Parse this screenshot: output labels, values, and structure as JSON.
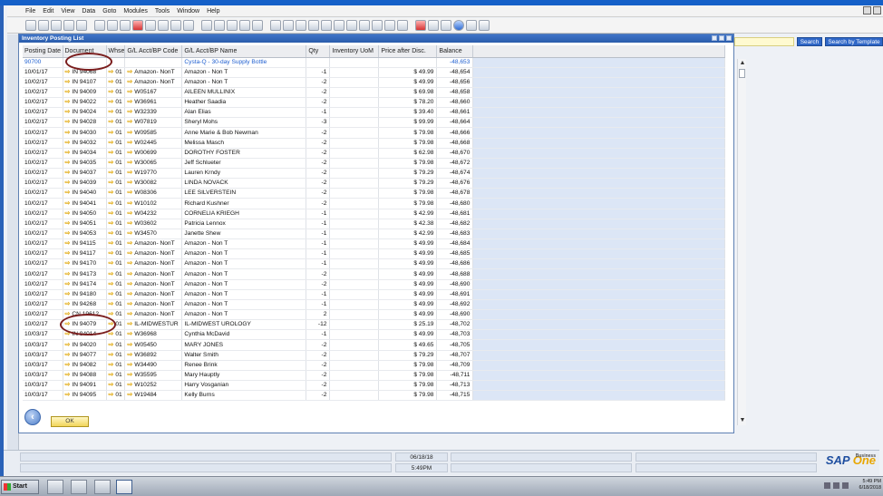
{
  "menu": [
    "File",
    "Edit",
    "View",
    "Data",
    "Goto",
    "Modules",
    "Tools",
    "Window",
    "Help"
  ],
  "search": {
    "placeholder": "",
    "button": "Search",
    "button_template": "Search by Template"
  },
  "dialog": {
    "title": "Inventory Posting List",
    "columns": [
      "Posting Date",
      "Document",
      "Whse",
      "G/L Acct/BP Code",
      "G/L Acct/BP Name",
      "Qty",
      "Inventory UoM",
      "Price after Disc.",
      "Balance"
    ],
    "ok_label": "OK"
  },
  "rows": [
    {
      "date": "90700",
      "doc": "",
      "whse": "",
      "code": "",
      "name": "Cysta-Q - 30-day Supply  Bottle",
      "qty": "",
      "uom": "",
      "price": "",
      "bal": "-48,653",
      "first": true
    },
    {
      "date": "10/01/17",
      "doc": "IN 94068",
      "whse": "01",
      "code": "Amazon- NonT",
      "name": "Amazon - Non T",
      "qty": "-1",
      "uom": "",
      "price": "$ 49.99",
      "bal": "-48,654"
    },
    {
      "date": "10/02/17",
      "doc": "IN 94107",
      "whse": "01",
      "code": "Amazon- NonT",
      "name": "Amazon - Non T",
      "qty": "-2",
      "uom": "",
      "price": "$ 49.99",
      "bal": "-48,656"
    },
    {
      "date": "10/02/17",
      "doc": "IN 94009",
      "whse": "01",
      "code": "W05167",
      "name": "AILEEN  MULLINIX",
      "qty": "-2",
      "uom": "",
      "price": "$ 69.98",
      "bal": "-48,658"
    },
    {
      "date": "10/02/17",
      "doc": "IN 94022",
      "whse": "01",
      "code": "W36961",
      "name": "Heather Saadia",
      "qty": "-2",
      "uom": "",
      "price": "$ 78.20",
      "bal": "-48,660"
    },
    {
      "date": "10/02/17",
      "doc": "IN 94024",
      "whse": "01",
      "code": "W32339",
      "name": "Alan Elias",
      "qty": "-1",
      "uom": "",
      "price": "$ 39.40",
      "bal": "-48,661"
    },
    {
      "date": "10/02/17",
      "doc": "IN 94028",
      "whse": "01",
      "code": "W07819",
      "name": "Sheryl Mohs",
      "qty": "-3",
      "uom": "",
      "price": "$ 99.99",
      "bal": "-48,664"
    },
    {
      "date": "10/02/17",
      "doc": "IN 94030",
      "whse": "01",
      "code": "W09585",
      "name": "Anne Marie & Bob Newman",
      "qty": "-2",
      "uom": "",
      "price": "$ 79.98",
      "bal": "-48,666"
    },
    {
      "date": "10/02/17",
      "doc": "IN 94032",
      "whse": "01",
      "code": "W02445",
      "name": "Melissa Masch",
      "qty": "-2",
      "uom": "",
      "price": "$ 79.98",
      "bal": "-48,668"
    },
    {
      "date": "10/02/17",
      "doc": "IN 94034",
      "whse": "01",
      "code": "W00699",
      "name": "DOROTHY  FOSTER",
      "qty": "-2",
      "uom": "",
      "price": "$ 62.98",
      "bal": "-48,670"
    },
    {
      "date": "10/02/17",
      "doc": "IN 94035",
      "whse": "01",
      "code": "W30065",
      "name": "Jeff Schlueter",
      "qty": "-2",
      "uom": "",
      "price": "$ 79.98",
      "bal": "-48,672"
    },
    {
      "date": "10/02/17",
      "doc": "IN 94037",
      "whse": "01",
      "code": "W19770",
      "name": "Lauren Krndy",
      "qty": "-2",
      "uom": "",
      "price": "$ 79.29",
      "bal": "-48,674"
    },
    {
      "date": "10/02/17",
      "doc": "IN 94039",
      "whse": "01",
      "code": "W30082",
      "name": "LINDA NOVACK",
      "qty": "-2",
      "uom": "",
      "price": "$ 79.29",
      "bal": "-48,676"
    },
    {
      "date": "10/02/17",
      "doc": "IN 94040",
      "whse": "01",
      "code": "W08306",
      "name": "LEE SILVERSTEIN",
      "qty": "-2",
      "uom": "",
      "price": "$ 79.98",
      "bal": "-48,678"
    },
    {
      "date": "10/02/17",
      "doc": "IN 94041",
      "whse": "01",
      "code": "W10102",
      "name": "Richard Kushner",
      "qty": "-2",
      "uom": "",
      "price": "$ 79.98",
      "bal": "-48,680"
    },
    {
      "date": "10/02/17",
      "doc": "IN 94050",
      "whse": "01",
      "code": "W04232",
      "name": "CORNELIA  KRIEGH",
      "qty": "-1",
      "uom": "",
      "price": "$ 42.99",
      "bal": "-48,681"
    },
    {
      "date": "10/02/17",
      "doc": "IN 94051",
      "whse": "01",
      "code": "W03602",
      "name": "Patricia  Lennox",
      "qty": "-1",
      "uom": "",
      "price": "$ 42.38",
      "bal": "-48,682"
    },
    {
      "date": "10/02/17",
      "doc": "IN 94053",
      "whse": "01",
      "code": "W34570",
      "name": "Janette Shew",
      "qty": "-1",
      "uom": "",
      "price": "$ 42.99",
      "bal": "-48,683"
    },
    {
      "date": "10/02/17",
      "doc": "IN 94115",
      "whse": "01",
      "code": "Amazon- NonT",
      "name": "Amazon - Non T",
      "qty": "-1",
      "uom": "",
      "price": "$ 49.99",
      "bal": "-48,684"
    },
    {
      "date": "10/02/17",
      "doc": "IN 94117",
      "whse": "01",
      "code": "Amazon- NonT",
      "name": "Amazon - Non T",
      "qty": "-1",
      "uom": "",
      "price": "$ 49.99",
      "bal": "-48,685"
    },
    {
      "date": "10/02/17",
      "doc": "IN 94170",
      "whse": "01",
      "code": "Amazon- NonT",
      "name": "Amazon - Non T",
      "qty": "-1",
      "uom": "",
      "price": "$ 49.99",
      "bal": "-48,686"
    },
    {
      "date": "10/02/17",
      "doc": "IN 94173",
      "whse": "01",
      "code": "Amazon- NonT",
      "name": "Amazon - Non T",
      "qty": "-2",
      "uom": "",
      "price": "$ 49.99",
      "bal": "-48,688"
    },
    {
      "date": "10/02/17",
      "doc": "IN 94174",
      "whse": "01",
      "code": "Amazon- NonT",
      "name": "Amazon - Non T",
      "qty": "-2",
      "uom": "",
      "price": "$ 49.99",
      "bal": "-48,690"
    },
    {
      "date": "10/02/17",
      "doc": "IN 94180",
      "whse": "01",
      "code": "Amazon- NonT",
      "name": "Amazon - Non T",
      "qty": "-1",
      "uom": "",
      "price": "$ 49.99",
      "bal": "-48,691"
    },
    {
      "date": "10/02/17",
      "doc": "IN 94268",
      "whse": "01",
      "code": "Amazon- NonT",
      "name": "Amazon - Non T",
      "qty": "-1",
      "uom": "",
      "price": "$ 49.99",
      "bal": "-48,692"
    },
    {
      "date": "10/02/17",
      "doc": "CN 19612",
      "whse": "01",
      "code": "Amazon- NonT",
      "name": "Amazon - Non T",
      "qty": "2",
      "uom": "",
      "price": "$ 49.99",
      "bal": "-48,690"
    },
    {
      "date": "10/02/17",
      "doc": "IN 94079",
      "whse": "01",
      "code": "IL-MIDWESTUR",
      "name": "IL-MIDWEST UROLOGY",
      "qty": "-12",
      "uom": "",
      "price": "$ 25.19",
      "bal": "-48,702"
    },
    {
      "date": "10/03/17",
      "doc": "IN 94014",
      "whse": "01",
      "code": "W36968",
      "name": "Cynthia McDavid",
      "qty": "-1",
      "uom": "",
      "price": "$ 49.99",
      "bal": "-48,703"
    },
    {
      "date": "10/03/17",
      "doc": "IN 94020",
      "whse": "01",
      "code": "W05450",
      "name": "MARY JONES",
      "qty": "-2",
      "uom": "",
      "price": "$ 49.65",
      "bal": "-48,705"
    },
    {
      "date": "10/03/17",
      "doc": "IN 94077",
      "whse": "01",
      "code": "W36892",
      "name": "Walter Smith",
      "qty": "-2",
      "uom": "",
      "price": "$ 79.29",
      "bal": "-48,707"
    },
    {
      "date": "10/03/17",
      "doc": "IN 94082",
      "whse": "01",
      "code": "W34490",
      "name": "Renee Brink",
      "qty": "-2",
      "uom": "",
      "price": "$ 79.98",
      "bal": "-48,709"
    },
    {
      "date": "10/03/17",
      "doc": "IN 94088",
      "whse": "01",
      "code": "W35595",
      "name": "Mary Hauptly",
      "qty": "-2",
      "uom": "",
      "price": "$ 79.98",
      "bal": "-48,711"
    },
    {
      "date": "10/03/17",
      "doc": "IN 94091",
      "whse": "01",
      "code": "W10252",
      "name": "Harry Vosganian",
      "qty": "-2",
      "uom": "",
      "price": "$ 79.98",
      "bal": "-48,713"
    },
    {
      "date": "10/03/17",
      "doc": "IN 94095",
      "whse": "01",
      "code": "W19484",
      "name": "Kelly Burns",
      "qty": "-2",
      "uom": "",
      "price": "$ 79.98",
      "bal": "-48,715"
    }
  ],
  "status": {
    "date": "06/18/18",
    "time": "5:49PM"
  },
  "brand": {
    "main": "SAP",
    "product": "Business",
    "edition": "One"
  },
  "taskbar": {
    "start_label": "Start",
    "clock_time": "5:49 PM",
    "clock_date": "6/18/2018"
  },
  "colors": {
    "title_blue": "#2a5cab",
    "ok_yellow": "#f2d55a",
    "arrow_orange": "#e0a500",
    "annotation": "#7a1d1d"
  }
}
